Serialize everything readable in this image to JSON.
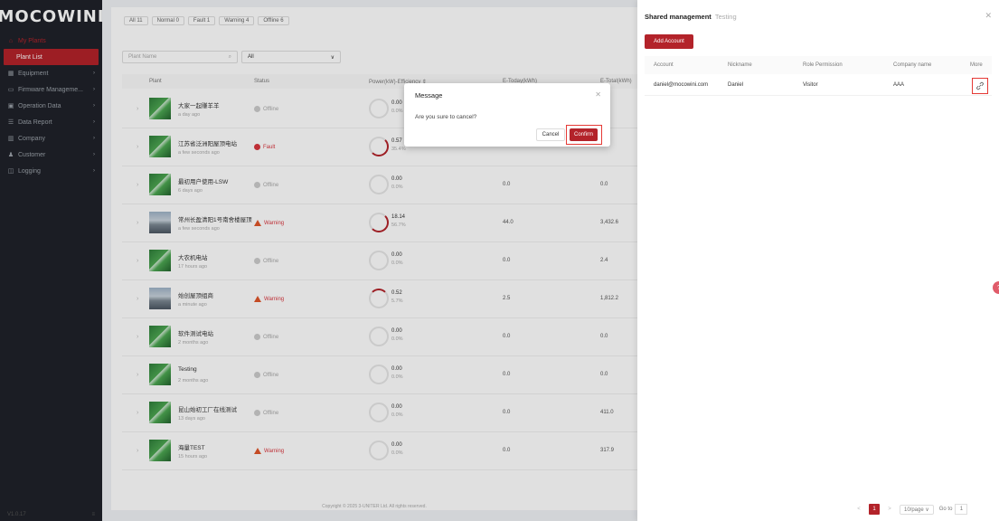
{
  "brand": "MOCOWINI",
  "sidebar": {
    "top_item": "My Plants",
    "items": [
      {
        "label": "Plant List",
        "icon": "list-icon",
        "active": true
      },
      {
        "label": "Equipment",
        "icon": "equipment-icon"
      },
      {
        "label": "Firmware Manageme...",
        "icon": "firmware-icon"
      },
      {
        "label": "Operation Data",
        "icon": "data-icon"
      },
      {
        "label": "Data Report",
        "icon": "report-icon"
      },
      {
        "label": "Company",
        "icon": "company-icon"
      },
      {
        "label": "Customer",
        "icon": "customer-icon"
      },
      {
        "label": "Logging",
        "icon": "logging-icon"
      }
    ],
    "footer_left": "V1.0.17",
    "footer_right": "≡"
  },
  "filters": {
    "tabs": [
      "All 11",
      "Normal 0",
      "Fault 1",
      "Warning 4",
      "Offline 6"
    ],
    "search_placeholder": "Plant Name",
    "select_value": "All"
  },
  "table": {
    "headers": {
      "plant": "Plant",
      "status": "Status",
      "power": "Power(kW)-Efficiency ⇕",
      "etoday": "E-Today(kWh)",
      "etotal": "E-Total(kWh)"
    },
    "rows": [
      {
        "name": "大家一起赚羊羊",
        "time": "a day ago",
        "status": "Offline",
        "kind": "offline",
        "power": "0.00",
        "eff": "0.0%",
        "etoday": "",
        "etotal": "",
        "gauge": "none",
        "photo": false
      },
      {
        "name": "江苏省泛洲阳屋顶电站",
        "time": "a few seconds ago",
        "status": "Fault",
        "kind": "fault",
        "power": "0.57",
        "eff": "35.4%",
        "etoday": "",
        "etotal": "",
        "gauge": "part",
        "photo": false
      },
      {
        "name": "最初用户使用-LSW",
        "time": "6 days ago",
        "status": "Offline",
        "kind": "offline",
        "power": "0.00",
        "eff": "0.0%",
        "etoday": "0.0",
        "etotal": "0.0",
        "gauge": "none",
        "photo": false
      },
      {
        "name": "常州长盈清阳1号南舍楼屋顶",
        "time": "a few seconds ago",
        "status": "Warning",
        "kind": "warning",
        "power": "18.14",
        "eff": "56.7%",
        "etoday": "44.0",
        "etotal": "3,432.6",
        "gauge": "part",
        "photo": true
      },
      {
        "name": "大农机电站",
        "time": "17 hours ago",
        "status": "Offline",
        "kind": "offline",
        "power": "0.00",
        "eff": "0.0%",
        "etoday": "0.0",
        "etotal": "2.4",
        "gauge": "none",
        "photo": false
      },
      {
        "name": "始创屋顶组商",
        "time": "a minute ago",
        "status": "Warning",
        "kind": "warning",
        "power": "0.52",
        "eff": "5.7%",
        "etoday": "2.5",
        "etotal": "1,812.2",
        "gauge": "tiny",
        "photo": true
      },
      {
        "name": "软件测试电站",
        "time": "2 months ago",
        "status": "Offline",
        "kind": "offline",
        "power": "0.00",
        "eff": "0.0%",
        "etoday": "0.0",
        "etotal": "0.0",
        "gauge": "none",
        "photo": false
      },
      {
        "name": "Testing",
        "time": "2 months ago",
        "status": "Offline",
        "kind": "offline",
        "power": "0.00",
        "eff": "0.0%",
        "etoday": "0.0",
        "etotal": "0.0",
        "gauge": "none",
        "photo": false
      },
      {
        "name": "昆山始初工厂在线测试",
        "time": "13 days ago",
        "status": "Offline",
        "kind": "offline",
        "power": "0.00",
        "eff": "0.0%",
        "etoday": "0.0",
        "etotal": "411.0",
        "gauge": "none",
        "photo": false
      },
      {
        "name": "海量TEST",
        "time": "15 hours ago",
        "status": "Warning",
        "kind": "warning",
        "power": "0.00",
        "eff": "0.0%",
        "etoday": "0.0",
        "etotal": "317.9",
        "gauge": "none",
        "photo": false
      }
    ]
  },
  "copyright": "Copyright © 2025 3-UNITER Ltd. All rights reserved.",
  "modal": {
    "title": "Message",
    "message": "Are you sure to cancel?",
    "cancel_label": "Cancel",
    "confirm_label": "Confirm"
  },
  "drawer": {
    "title": "Shared management",
    "subtitle": "Testing",
    "add_label": "Add Account",
    "headers": {
      "account": "Account",
      "nickname": "Nickname",
      "role": "Role Permission",
      "company": "Company name",
      "more": "More"
    },
    "rows": [
      {
        "account": "daniel@mocowini.com",
        "nickname": "Daniel",
        "role": "Visitor",
        "company": "AAA"
      }
    ],
    "pager": {
      "prev": "<",
      "page": "1",
      "next": ">",
      "size": "10/page ∨",
      "goto": "Go to",
      "goto_value": "1"
    }
  },
  "colors": {
    "accent": "#b3232a",
    "sidebar_bg": "#1f2229",
    "highlight_border": "#e53935"
  }
}
